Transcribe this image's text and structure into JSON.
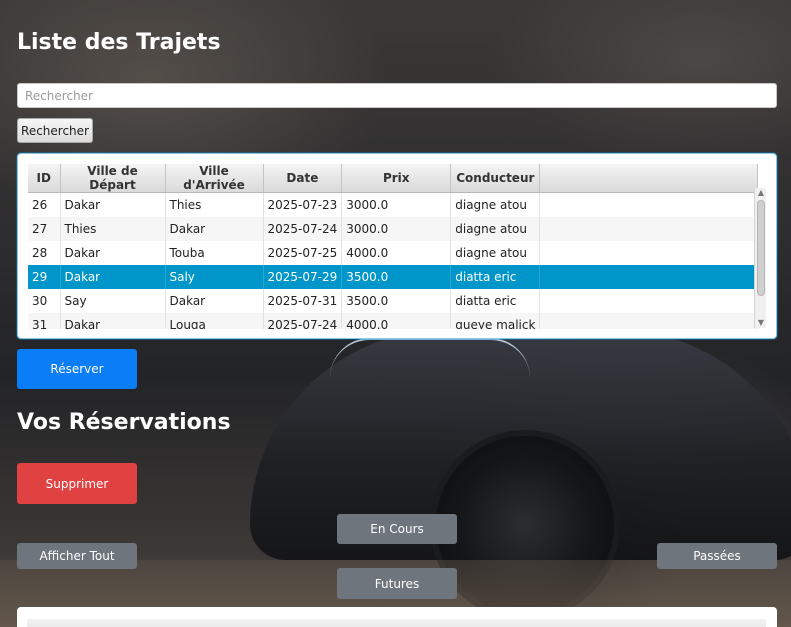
{
  "trajets": {
    "title": "Liste des Trajets",
    "search_placeholder": "Rechercher",
    "search_value": "",
    "search_button": "Rechercher",
    "columns": [
      "ID",
      "Ville de Départ",
      "Ville d'Arrivée",
      "Date",
      "Prix",
      "Conducteur"
    ],
    "rows": [
      {
        "id": "26",
        "depart": "Dakar",
        "arrivee": "Thies",
        "date": "2025-07-23",
        "prix": "3000.0",
        "conducteur": "diagne atou"
      },
      {
        "id": "27",
        "depart": "Thies",
        "arrivee": "Dakar",
        "date": "2025-07-24",
        "prix": "3000.0",
        "conducteur": "diagne atou"
      },
      {
        "id": "28",
        "depart": "Dakar",
        "arrivee": "Touba",
        "date": "2025-07-25",
        "prix": "4000.0",
        "conducteur": "diagne atou"
      },
      {
        "id": "29",
        "depart": "Dakar",
        "arrivee": "Saly",
        "date": "2025-07-29",
        "prix": "3500.0",
        "conducteur": "diatta eric"
      },
      {
        "id": "30",
        "depart": "Say",
        "arrivee": "Dakar",
        "date": "2025-07-31",
        "prix": "3500.0",
        "conducteur": "diatta eric"
      },
      {
        "id": "31",
        "depart": "Dakar",
        "arrivee": "Louga",
        "date": "2025-07-24",
        "prix": "4000.0",
        "conducteur": "gueye malick"
      }
    ],
    "selected_row_id": "29",
    "reserve_button": "Réserver"
  },
  "reservations": {
    "title": "Vos Réservations",
    "delete_button": "Supprimer",
    "filters": {
      "en_cours": "En Cours",
      "afficher_tout": "Afficher Tout",
      "passees": "Passées",
      "futures": "Futures"
    }
  },
  "colors": {
    "reserve": "#0a7df7",
    "delete": "#e04242",
    "filter": "#6f757d",
    "selection": "#0096c9"
  }
}
